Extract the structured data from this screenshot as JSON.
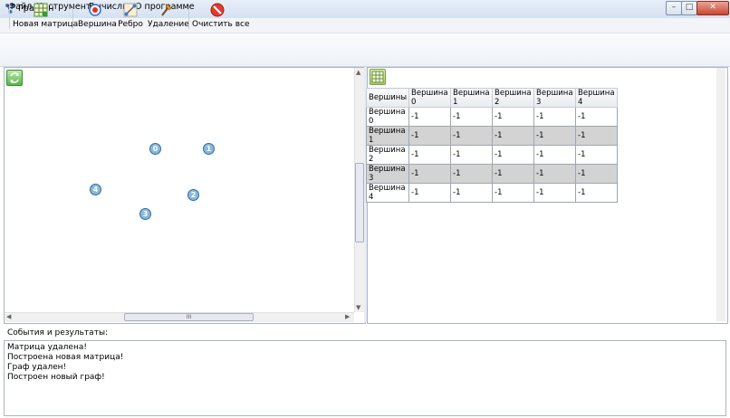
{
  "window": {
    "title": "ГрафОн",
    "minimize": "–",
    "maximize": "□",
    "close": "✕"
  },
  "menu": [
    "Файл",
    "Инструменты",
    "Вычислить",
    "О программе"
  ],
  "toolbar": {
    "new_matrix": "Новая матрица",
    "vertex": "Вершина",
    "edge": "Ребро",
    "delete": "Удаление",
    "clear_all": "Очистить все"
  },
  "canvas": {
    "vertices": [
      "0",
      "1",
      "2",
      "3",
      "4"
    ],
    "hscroll_grip": "III"
  },
  "matrix": {
    "header": [
      "Вершины",
      "Вершина 0",
      "Вершина 1",
      "Вершина 2",
      "Вершина 3",
      "Вершина 4"
    ],
    "rows": [
      [
        "Вершина 0",
        "-1",
        "-1",
        "-1",
        "-1",
        "-1"
      ],
      [
        "Вершина 1",
        "-1",
        "-1",
        "-1",
        "-1",
        "-1"
      ],
      [
        "Вершина 2",
        "-1",
        "-1",
        "-1",
        "-1",
        "-1"
      ],
      [
        "Вершина 3",
        "-1",
        "-1",
        "-1",
        "-1",
        "-1"
      ],
      [
        "Вершина 4",
        "-1",
        "-1",
        "-1",
        "-1",
        "-1"
      ]
    ]
  },
  "events": {
    "label": "События и результаты:",
    "lines": [
      "Матрица удалена!",
      "Построена новая матрица!",
      "Граф удален!",
      "Построен новый граф!"
    ]
  }
}
